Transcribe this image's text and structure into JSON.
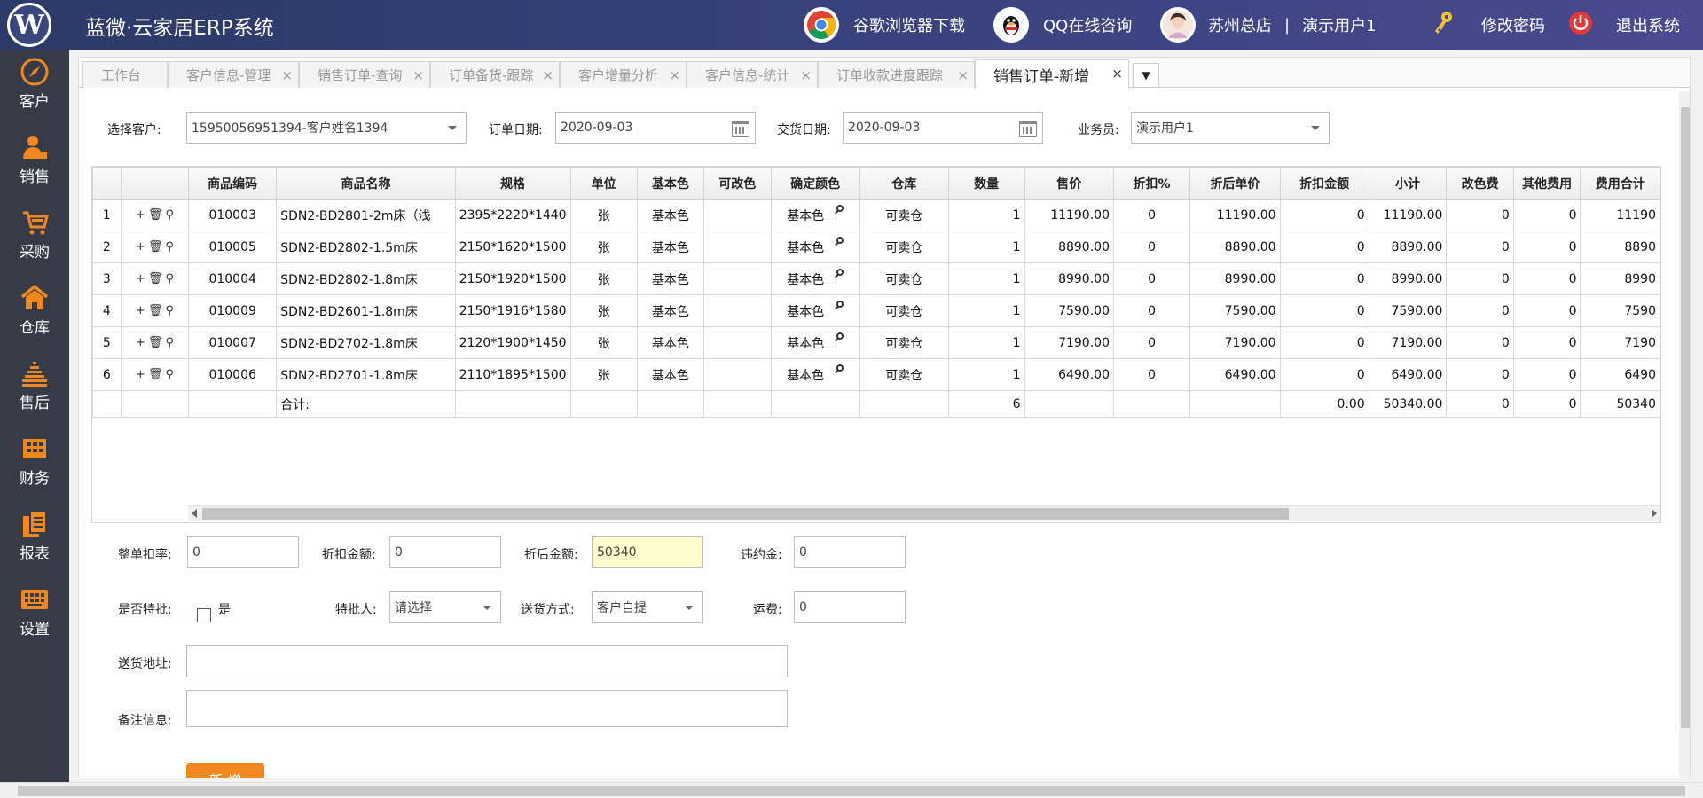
{
  "app": {
    "logo_text": "W",
    "title": "蓝微·云家居ERP系统"
  },
  "topbar": {
    "chrome_label": "谷歌浏览器下载",
    "qq_label": "QQ在线咨询",
    "store": "苏州总店",
    "separator": "|",
    "user": "演示用户1",
    "change_password": "修改密码",
    "logout": "退出系统"
  },
  "sidebar": {
    "items": [
      {
        "label": "客户",
        "icon": "compass-icon"
      },
      {
        "label": "销售",
        "icon": "person-icon"
      },
      {
        "label": "采购",
        "icon": "cart-icon"
      },
      {
        "label": "仓库",
        "icon": "house-icon"
      },
      {
        "label": "售后",
        "icon": "bar-icon"
      },
      {
        "label": "财务",
        "icon": "grid-icon"
      },
      {
        "label": "报表",
        "icon": "document-icon"
      },
      {
        "label": "设置",
        "icon": "keyboard-icon"
      }
    ]
  },
  "tabs": [
    {
      "label": "工作台",
      "closable": false
    },
    {
      "label": "客户信息-管理",
      "closable": true
    },
    {
      "label": "销售订单-查询",
      "closable": true
    },
    {
      "label": "订单备货-跟踪",
      "closable": true
    },
    {
      "label": "客户增量分析",
      "closable": true
    },
    {
      "label": "客户信息-统计",
      "closable": true
    },
    {
      "label": "订单收款进度跟踪",
      "closable": true
    },
    {
      "label": "销售订单-新增",
      "closable": true,
      "active": true
    }
  ],
  "close_glyph": "×",
  "form": {
    "customer_label": "选择客户:",
    "customer_value": "15950056951394-客户姓名1394",
    "order_date_label": "订单日期:",
    "order_date_value": "2020-09-03",
    "delivery_date_label": "交货日期:",
    "delivery_date_value": "2020-09-03",
    "salesman_label": "业务员:",
    "salesman_value": "演示用户1"
  },
  "grid": {
    "headers": [
      "",
      "",
      "商品编码",
      "商品名称",
      "规格",
      "单位",
      "基本色",
      "可改色",
      "确定颜色",
      "仓库",
      "数量",
      "售价",
      "折扣%",
      "折后单价",
      "折扣金额",
      "小计",
      "改色费",
      "其他费用",
      "费用合计"
    ],
    "rows": [
      {
        "no": "1",
        "code": "010003",
        "name": "SDN2-BD2801-2m床（浅",
        "spec": "2395*2220*1440",
        "unit": "张",
        "base": "基本色",
        "change": "",
        "color": "基本色",
        "wh": "可卖仓",
        "qty": "1",
        "price": "11190.00",
        "disc": "0",
        "dprice": "11190.00",
        "damt": "0",
        "sub": "11190.00",
        "cfee": "0",
        "ofee": "0",
        "total": "11190"
      },
      {
        "no": "2",
        "code": "010005",
        "name": "SDN2-BD2802-1.5m床",
        "spec": "2150*1620*1500",
        "unit": "张",
        "base": "基本色",
        "change": "",
        "color": "基本色",
        "wh": "可卖仓",
        "qty": "1",
        "price": "8890.00",
        "disc": "0",
        "dprice": "8890.00",
        "damt": "0",
        "sub": "8890.00",
        "cfee": "0",
        "ofee": "0",
        "total": "8890"
      },
      {
        "no": "3",
        "code": "010004",
        "name": "SDN2-BD2802-1.8m床",
        "spec": "2150*1920*1500",
        "unit": "张",
        "base": "基本色",
        "change": "",
        "color": "基本色",
        "wh": "可卖仓",
        "qty": "1",
        "price": "8990.00",
        "disc": "0",
        "dprice": "8990.00",
        "damt": "0",
        "sub": "8990.00",
        "cfee": "0",
        "ofee": "0",
        "total": "8990"
      },
      {
        "no": "4",
        "code": "010009",
        "name": "SDN2-BD2601-1.8m床",
        "spec": "2150*1916*1580",
        "unit": "张",
        "base": "基本色",
        "change": "",
        "color": "基本色",
        "wh": "可卖仓",
        "qty": "1",
        "price": "7590.00",
        "disc": "0",
        "dprice": "7590.00",
        "damt": "0",
        "sub": "7590.00",
        "cfee": "0",
        "ofee": "0",
        "total": "7590"
      },
      {
        "no": "5",
        "code": "010007",
        "name": "SDN2-BD2702-1.8m床",
        "spec": "2120*1900*1450",
        "unit": "张",
        "base": "基本色",
        "change": "",
        "color": "基本色",
        "wh": "可卖仓",
        "qty": "1",
        "price": "7190.00",
        "disc": "0",
        "dprice": "7190.00",
        "damt": "0",
        "sub": "7190.00",
        "cfee": "0",
        "ofee": "0",
        "total": "7190"
      },
      {
        "no": "6",
        "code": "010006",
        "name": "SDN2-BD2701-1.8m床",
        "spec": "2110*1895*1500",
        "unit": "张",
        "base": "基本色",
        "change": "",
        "color": "基本色",
        "wh": "可卖仓",
        "qty": "1",
        "price": "6490.00",
        "disc": "0",
        "dprice": "6490.00",
        "damt": "0",
        "sub": "6490.00",
        "cfee": "0",
        "ofee": "0",
        "total": "6490"
      }
    ],
    "sum": {
      "label": "合计:",
      "qty": "6",
      "damt": "0.00",
      "sub": "50340.00",
      "cfee": "0",
      "ofee": "0",
      "total": "50340"
    },
    "row_ops": {
      "add": "+",
      "delete": "🗑",
      "search": "⚲"
    }
  },
  "bottom": {
    "whole_discount_label": "整单扣率:",
    "whole_discount_value": "0",
    "discount_amount_label": "折扣金额:",
    "discount_amount_value": "0",
    "after_discount_label": "折后金额:",
    "after_discount_value": "50340",
    "penalty_label": "违约金:",
    "penalty_value": "0",
    "special_label": "是否特批:",
    "special_yes": "是",
    "approver_label": "特批人:",
    "approver_value": "请选择",
    "delivery_method_label": "送货方式:",
    "delivery_method_value": "客户自提",
    "freight_label": "运费:",
    "freight_value": "0",
    "address_label": "送货地址:",
    "address_value": "",
    "remark_label": "备注信息:",
    "remark_value": "",
    "submit_label": "新 增"
  },
  "colors": {
    "topbar": "#3b4380",
    "sidebar": "#363b47",
    "accent": "#f0871f",
    "highlight_field": "#fffbcc"
  }
}
